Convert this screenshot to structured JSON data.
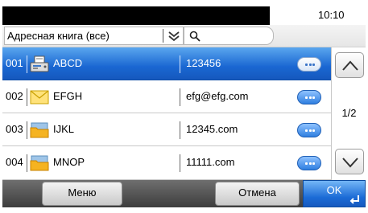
{
  "status": {
    "time": "10:10"
  },
  "filter": {
    "selected": "Адресная книга (все)",
    "search_placeholder": ""
  },
  "rows": [
    {
      "num": "001",
      "icon": "fax-icon",
      "name": "ABCD",
      "address": "123456",
      "selected": true
    },
    {
      "num": "002",
      "icon": "email-envelope-icon",
      "name": "EFGH",
      "address": "efg@efg.com",
      "selected": false
    },
    {
      "num": "003",
      "icon": "folder-icon",
      "name": "IJKL",
      "address": "12345.com",
      "selected": false
    },
    {
      "num": "004",
      "icon": "folder-icon",
      "name": "MNOP",
      "address": "11111.com",
      "selected": false
    }
  ],
  "pager": {
    "page": "1/2"
  },
  "buttons": {
    "menu": "Меню",
    "cancel": "Отмена",
    "ok": "OK"
  },
  "colors": {
    "selected_row": "#1a67d2",
    "ok_button": "#1b6bd6",
    "bottom_bar": "#4a4a4a"
  }
}
